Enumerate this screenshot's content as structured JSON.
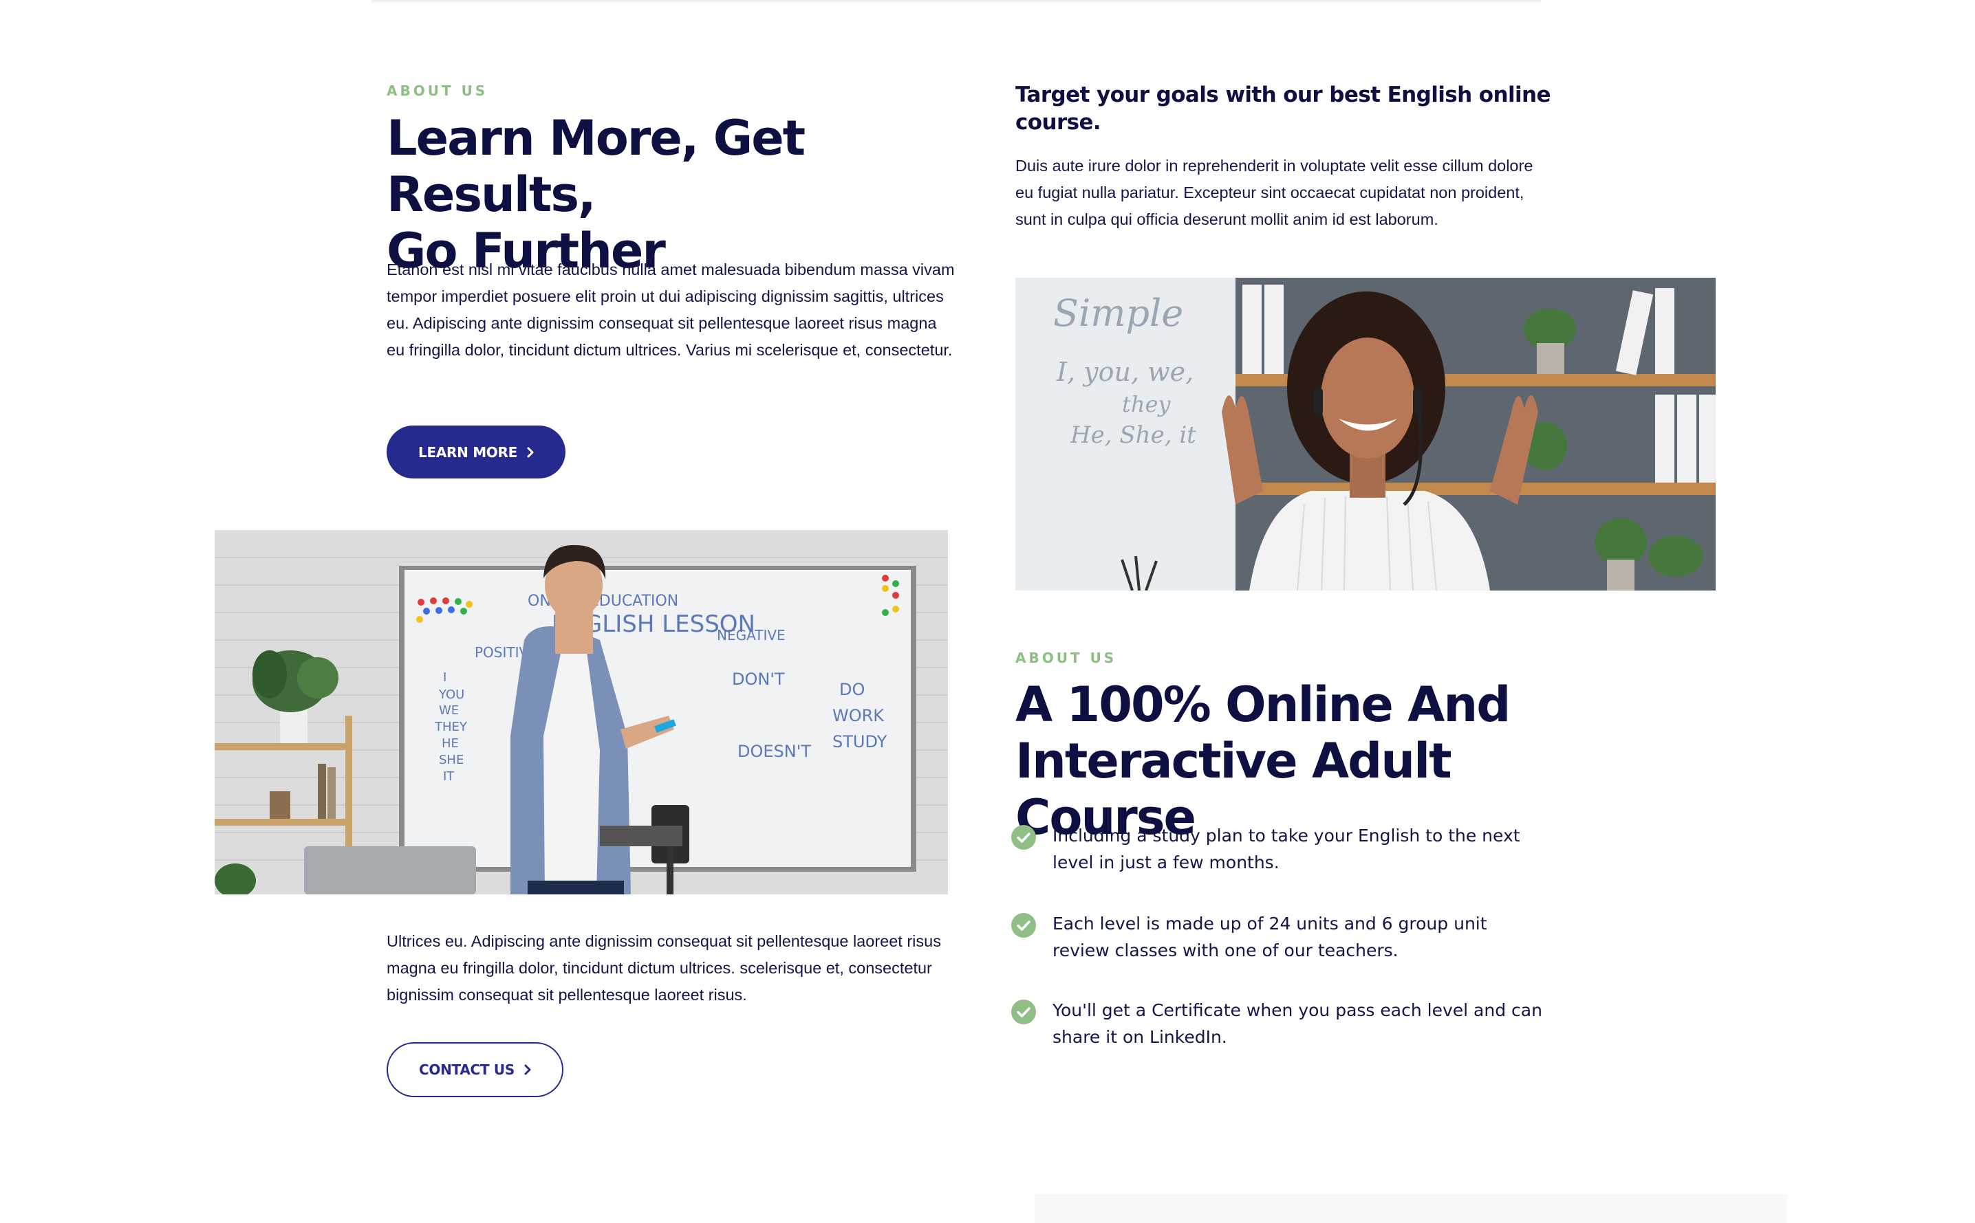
{
  "about_left": {
    "eyebrow": "ABOUT US",
    "heading_line1": "Learn More, Get Results,",
    "heading_line2": "Go Further",
    "paragraph": "Etanon est nisl mi vitae faucibus nulla amet malesuada bibendum massa vivam tempor imperdiet posuere elit proin ut dui adipiscing dignissim sagittis, ultrices eu. Adipiscing ante dignissim consequat sit pellentesque laoreet risus magna eu fringilla dolor, tincidunt dictum ultrices. Varius mi scelerisque et, consectetur.",
    "button_label": "LEARN MORE",
    "button_icon": "chevron-right-icon"
  },
  "teacher_whiteboard": {
    "board_text": [
      "ONLINE EDUCATION",
      "ENGLISH LESSON",
      "POSITIVE",
      "NEGATIVE",
      "I",
      "YOU",
      "WE",
      "THEY",
      "HE",
      "SHE",
      "IT",
      "DON'T",
      "DOESN'T",
      "DO",
      "WORK",
      "STUDY"
    ]
  },
  "left_bottom": {
    "paragraph": "Ultrices eu. Adipiscing ante dignissim consequat sit pellentesque laoreet risus magna eu fringilla dolor, tincidunt dictum ultrices. scelerisque et, consectetur bignissim consequat sit pellentesque laoreet risus.",
    "button_label": "CONTACT US",
    "button_icon": "chevron-right-icon"
  },
  "right_top": {
    "heading": "Target your goals with our best English online course.",
    "paragraph": "Duis aute irure dolor in reprehenderit in voluptate velit esse cillum dolore eu fugiat nulla pariatur. Excepteur sint occaecat cupidatat non proident, sunt in culpa qui officia deserunt mollit anim id est laborum."
  },
  "woman_photo": {
    "board_text": [
      "Simple",
      "I, you, we,",
      "they",
      "He, She, it"
    ]
  },
  "about_right": {
    "eyebrow": "ABOUT US",
    "heading_line1": "A 100% Online And",
    "heading_line2": "Interactive Adult Course",
    "features": [
      {
        "icon": "check-circle-icon",
        "text": "Including a study plan to take your English to the next level in just a few months."
      },
      {
        "icon": "check-circle-icon",
        "text": "Each level is made up of 24 units and 6 group unit review classes with one of our teachers."
      },
      {
        "icon": "check-circle-icon",
        "text": "You'll get a Certificate when you pass each level and can share it on LinkedIn."
      }
    ]
  },
  "colors": {
    "navy": "#0e1042",
    "button_blue": "#262a8f",
    "accent_green": "#8fbf85",
    "text": "#14154a"
  }
}
